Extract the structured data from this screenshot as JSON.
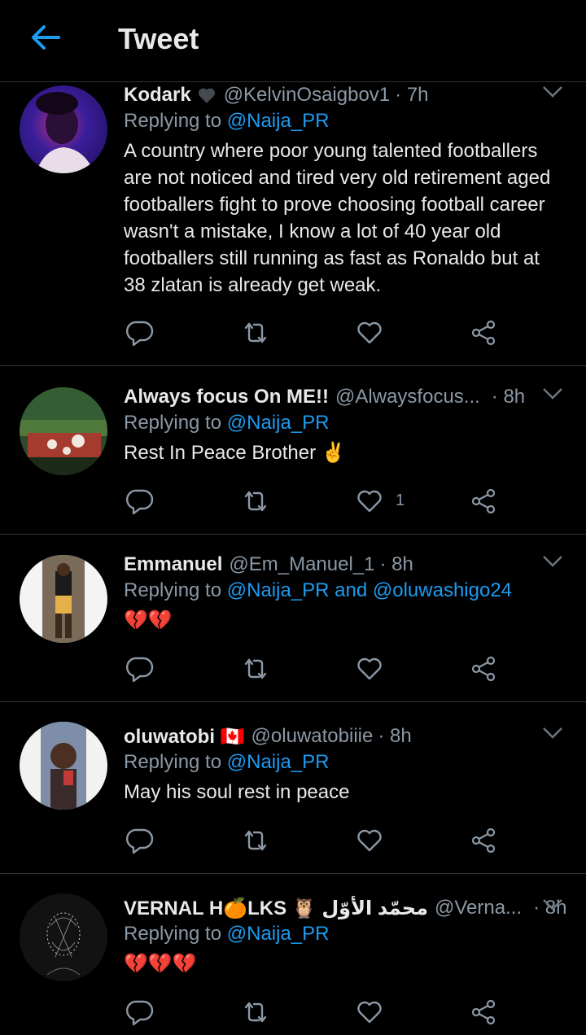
{
  "header": {
    "title": "Tweet"
  },
  "tweets": [
    {
      "name": "Kodark",
      "handle": "@KelvinOsaigbov1",
      "meta": "· 7h",
      "replying_prefix": "Replying to",
      "replying_to": "@Naija_PR",
      "body": "A country where poor young talented footballers are not noticed and tired very old retirement aged footballers fight to prove choosing football career wasn't a mistake, I know a lot of 40 year old footballers still running as fast as Ronaldo but at 38 zlatan is already get weak.",
      "likes": ""
    },
    {
      "name": "Always focus On ME!!",
      "handle": "@Alwaysfocus...",
      "meta": "· 8h",
      "replying_prefix": "Replying to",
      "replying_to": "@Naija_PR",
      "body": "Rest In Peace Brother ✌️",
      "likes": "1"
    },
    {
      "name": "Emmanuel",
      "handle": "@Em_Manuel_1",
      "meta": "· 8h",
      "replying_prefix": "Replying to",
      "replying_to": "@Naija_PR and @oluwashigo24",
      "body": "💔💔",
      "likes": ""
    },
    {
      "name": "oluwatobi 🇨🇦",
      "handle": "@oluwatobiiie",
      "meta": "· 8h",
      "replying_prefix": "Replying to",
      "replying_to": "@Naija_PR",
      "body": "May his soul rest in peace",
      "likes": ""
    },
    {
      "name": "VERNAL H🍊LKS 🦉 محمّد الأوّل",
      "handle": "@Verna...",
      "meta": "· 8h",
      "replying_prefix": "Replying to",
      "replying_to": "@Naija_PR",
      "body": "💔💔💔",
      "likes": ""
    }
  ],
  "colors": {
    "background": "#000000",
    "link": "#1d9bf0",
    "muted": "#8b98a5",
    "divider": "#2f3336"
  }
}
